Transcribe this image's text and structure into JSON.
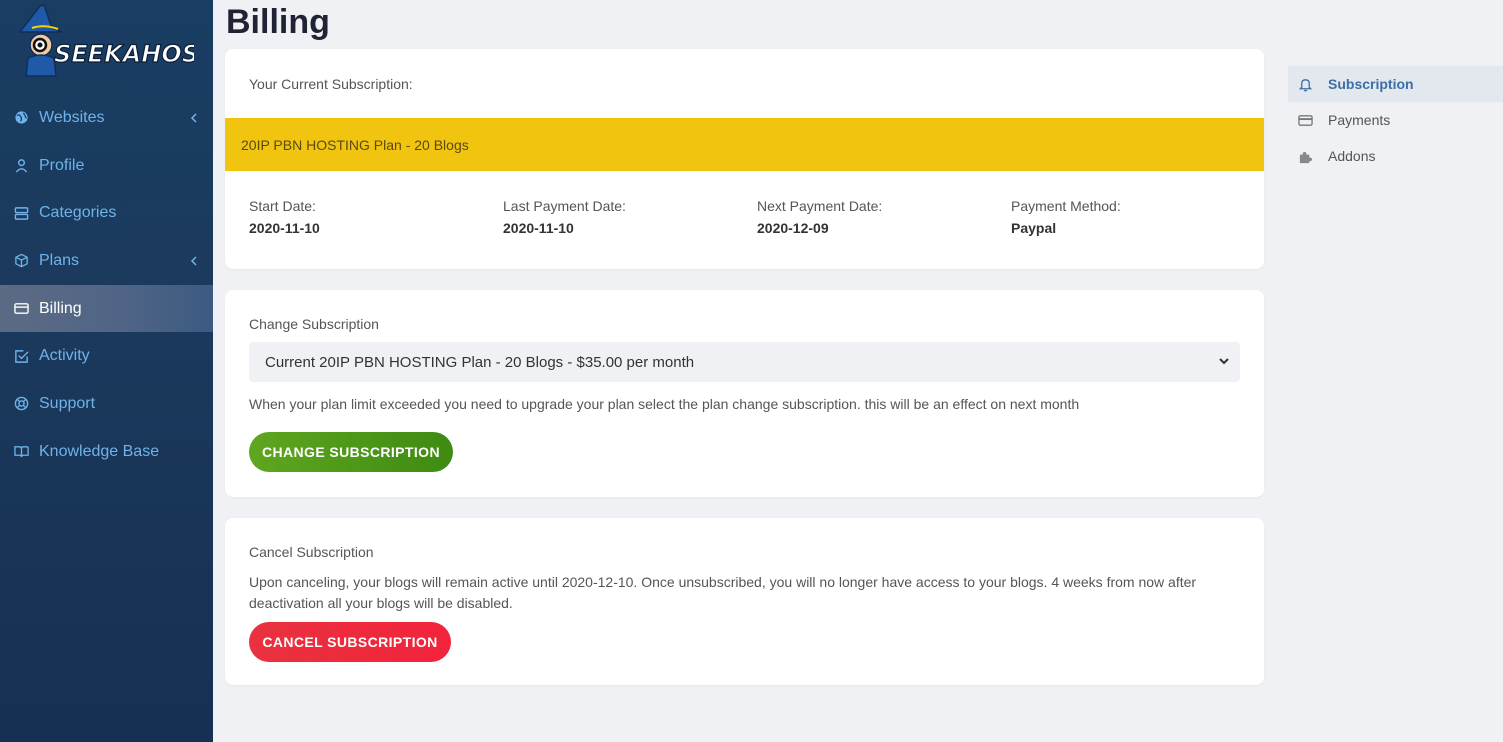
{
  "brand": {
    "logo_text": "SEEKAHOST"
  },
  "sidebar": {
    "items": [
      {
        "label": "Websites",
        "icon": "globe-icon",
        "has_submenu": true
      },
      {
        "label": "Profile",
        "icon": "user-icon",
        "has_submenu": false
      },
      {
        "label": "Categories",
        "icon": "server-icon",
        "has_submenu": false
      },
      {
        "label": "Plans",
        "icon": "box-icon",
        "has_submenu": true
      },
      {
        "label": "Billing",
        "icon": "credit-card-icon",
        "has_submenu": false,
        "active": true
      },
      {
        "label": "Activity",
        "icon": "check-square-icon",
        "has_submenu": false
      },
      {
        "label": "Support",
        "icon": "life-buoy-icon",
        "has_submenu": false
      },
      {
        "label": "Knowledge Base",
        "icon": "book-open-icon",
        "has_submenu": false
      }
    ]
  },
  "page": {
    "title": "Billing"
  },
  "current": {
    "label": "Your Current Subscription:",
    "plan_name": "20IP PBN HOSTING Plan - 20 Blogs",
    "dates": [
      {
        "label": "Start Date:",
        "value": "2020-11-10"
      },
      {
        "label": "Last Payment Date:",
        "value": "2020-11-10"
      },
      {
        "label": "Next Payment Date:",
        "value": "2020-12-09"
      },
      {
        "label": "Payment Method:",
        "value": "Paypal"
      }
    ]
  },
  "change": {
    "title": "Change Subscription",
    "selected_option": "Current 20IP PBN HOSTING Plan - 20 Blogs - $35.00 per month",
    "hint": "When your plan limit exceeded you need to upgrade your plan select the plan change subscription. this will be an effect on next month",
    "button_label": "CHANGE SUBSCRIPTION"
  },
  "cancel": {
    "title": "Cancel Subscription",
    "text": "Upon canceling, your blogs will remain active until 2020-12-10. Once unsubscribed, you will no longer have access to your blogs. 4 weeks from now after deactivation all your blogs will be disabled.",
    "button_label": "CANCEL SUBSCRIPTION"
  },
  "right_nav": {
    "items": [
      {
        "label": "Subscription",
        "icon": "bell-icon",
        "active": true
      },
      {
        "label": "Payments",
        "icon": "credit-card-icon",
        "active": false
      },
      {
        "label": "Addons",
        "icon": "puzzle-icon",
        "active": false
      }
    ]
  },
  "colors": {
    "sidebar_bg": "#1a3d63",
    "accent_yellow": "#f1c40f",
    "button_green": "#4c9a18",
    "button_red": "#ee2a3d",
    "link_blue": "#6fb3ea"
  }
}
